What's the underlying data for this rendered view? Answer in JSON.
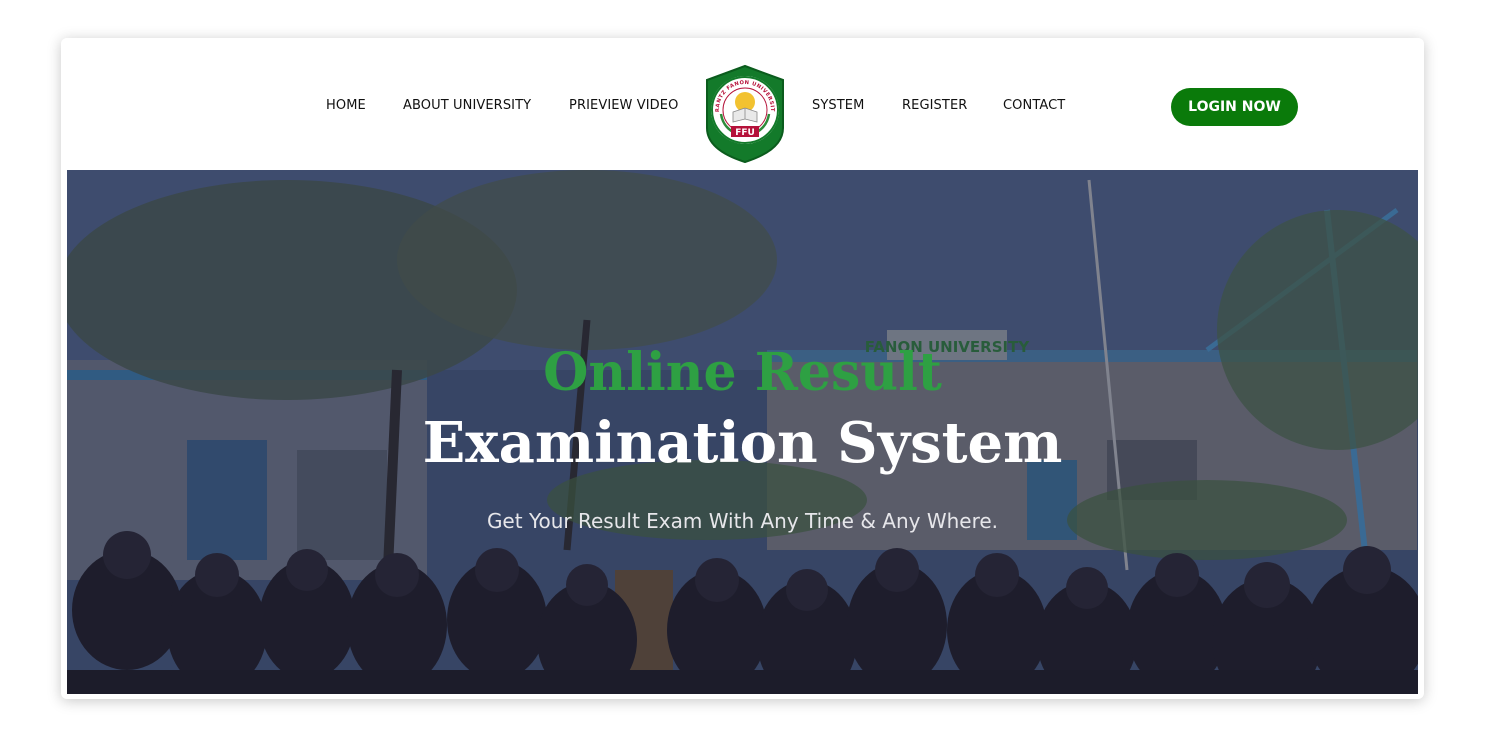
{
  "nav": {
    "items": [
      {
        "label": "HOME"
      },
      {
        "label": "ABOUT UNIVERSITY"
      },
      {
        "label": "PRIEVIEW VIDEO"
      },
      {
        "label": "SYSTEM"
      },
      {
        "label": "REGISTER"
      },
      {
        "label": "CONTACT"
      }
    ],
    "login_label": "LOGIN NOW",
    "logo": {
      "arc_text": "FRANTZ FANON UNIVERSITY",
      "badge_text": "FFU"
    }
  },
  "hero": {
    "title_line1": "Online Result",
    "title_line2": "Examination System",
    "subtitle": "Get Your Result Exam With Any Time & Any Where.",
    "building_sign": "FANON UNIVERSITY"
  },
  "colors": {
    "brand_green": "#0a7a0a",
    "title_green": "#2ea043",
    "logo_red": "#b5123a"
  }
}
